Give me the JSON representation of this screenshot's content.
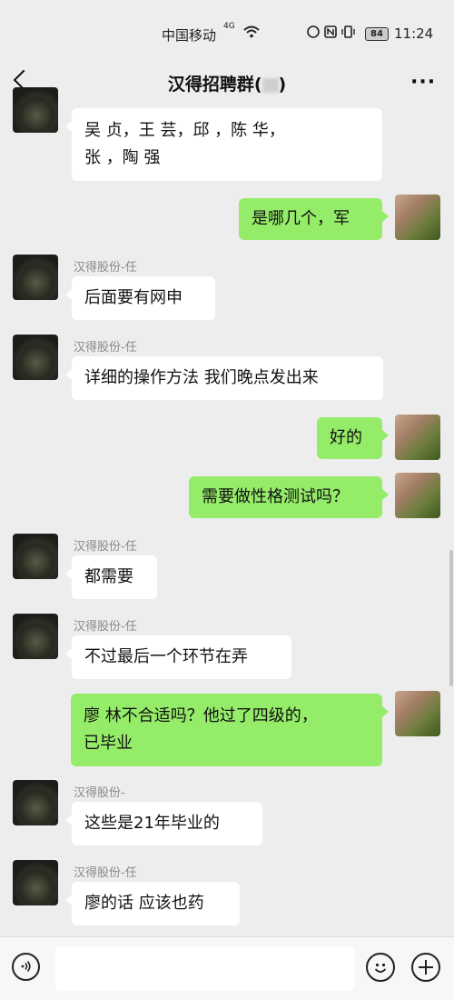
{
  "status_bar": {
    "carrier": "中国移动",
    "network": "4G",
    "battery": "84",
    "time": "11:24"
  },
  "header": {
    "title": "汉得招聘群(",
    "title_suffix": ")"
  },
  "messages": [
    {
      "side": "left",
      "line1": "吴 贞，王 芸，邱 ，陈 华，",
      "line2": "张 ，陶 强"
    },
    {
      "side": "right",
      "text": "是哪几个，军"
    },
    {
      "side": "left",
      "sender": "汉得股份-任",
      "text": "后面要有网申"
    },
    {
      "side": "left",
      "sender": "汉得股份-任",
      "text": "详细的操作方法 我们晚点发出来"
    },
    {
      "side": "right",
      "text": "好的"
    },
    {
      "side": "right",
      "text": "需要做性格测试吗？"
    },
    {
      "side": "left",
      "sender": "汉得股份-任",
      "text": "都需要"
    },
    {
      "side": "left",
      "sender": "汉得股份-任",
      "text": "不过最后一个环节在弄"
    },
    {
      "side": "right",
      "line1": "廖 林不合适吗？他过了四级的，",
      "line2": "已毕业"
    },
    {
      "side": "left",
      "sender": "汉得股份-",
      "text": "这些是21年毕业的"
    },
    {
      "side": "left",
      "sender": "汉得股份-任",
      "text": "廖的话 应该也药"
    }
  ],
  "icons": {
    "back": "back-arrow-icon",
    "more": "more-icon",
    "voice": "voice-icon",
    "emoji": "emoji-icon",
    "plus": "plus-icon"
  },
  "colors": {
    "background": "#ededed",
    "bubble_self": "#95ec69",
    "bubble_other": "#ffffff"
  }
}
